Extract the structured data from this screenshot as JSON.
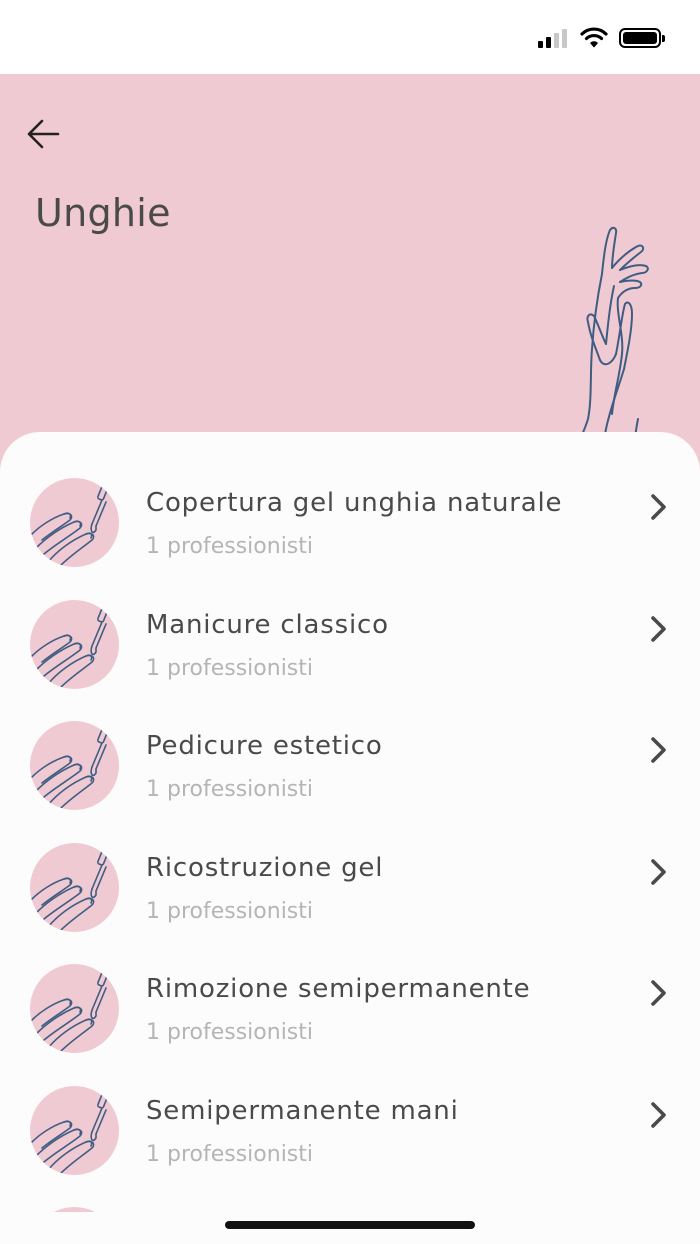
{
  "status_bar": {
    "signal_icon": "cellular-signal-icon",
    "wifi_icon": "wifi-icon",
    "battery_icon": "battery-icon"
  },
  "header": {
    "title": "Unghie",
    "back_icon": "arrow-left-icon",
    "background_color": "#f0cad2",
    "illustration": "hands-line-illustration"
  },
  "services": [
    {
      "title": "Copertura gel unghia naturale",
      "subtitle": "1 professionisti",
      "icon": "nail-polish-icon"
    },
    {
      "title": "Manicure classico",
      "subtitle": "1 professionisti",
      "icon": "nail-polish-icon"
    },
    {
      "title": "Pedicure estetico",
      "subtitle": "1 professionisti",
      "icon": "nail-polish-icon"
    },
    {
      "title": "Ricostruzione gel",
      "subtitle": "1 professionisti",
      "icon": "nail-polish-icon"
    },
    {
      "title": "Rimozione semipermanente",
      "subtitle": "1 professionisti",
      "icon": "nail-polish-icon"
    },
    {
      "title": "Semipermanente mani",
      "subtitle": "1 professionisti",
      "icon": "nail-polish-icon"
    }
  ],
  "colors": {
    "accent_pink": "#f0cad2",
    "illustration_stroke": "#3f5d82",
    "text_primary": "#4a4a4a",
    "text_secondary": "#b5b5b5"
  }
}
